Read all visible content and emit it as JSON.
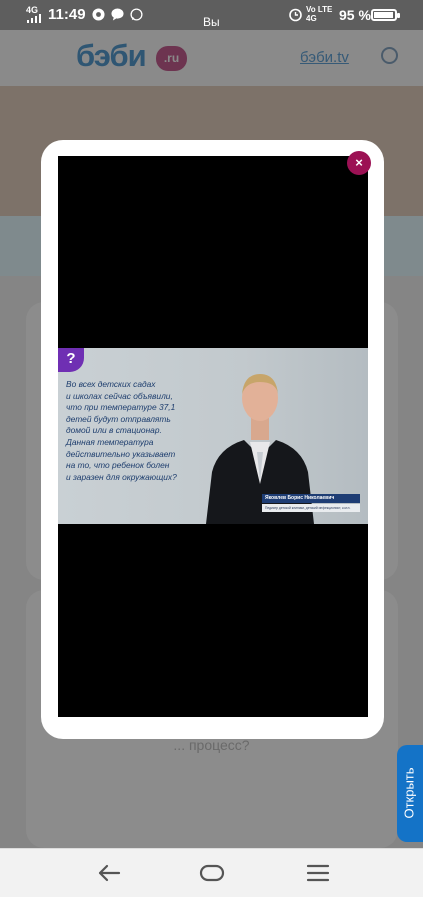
{
  "status_bar": {
    "network": "4G",
    "time": "11:49",
    "center_label": "Вы",
    "right_network_top": "Vo LTE",
    "right_network_bottom": "4G",
    "battery_percent": "95 %",
    "battery_level": 0.95
  },
  "background_page": {
    "logo_text": "бэби",
    "logo_badge": ".ru",
    "header_link": "бэби.tv",
    "question_text": "... процесс?"
  },
  "modal": {
    "close_label": "×",
    "video": {
      "question_badge": "?",
      "quote_lines": [
        "Во всех детских садах",
        "и школах сейчас объявили,",
        "что при температуре 37,1",
        "детей будут отправлять",
        "домой или в стационар.",
        "Данная температура",
        "действительно указывает",
        "на то, что ребенок болен",
        "и заразен для окружающих?"
      ],
      "speaker_name": "Яковлев Борис Николаевич",
      "speaker_role": "Педиатр детской клиники, детский инфекционист, к.м.н."
    }
  },
  "open_tab": {
    "label": "Открыть"
  },
  "colors": {
    "accent_close": "#9c1154",
    "question_purple": "#6f2fb3",
    "open_tab_blue": "#1473c7",
    "name_plate_blue": "#1e3d74"
  }
}
